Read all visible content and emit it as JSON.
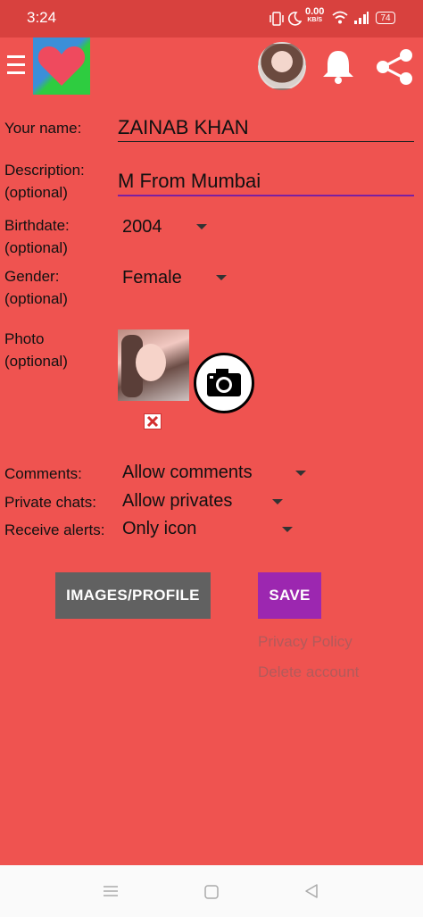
{
  "status_bar": {
    "time": "3:24",
    "net_speed_value": "0.00",
    "net_speed_unit": "KB/S",
    "battery": "74"
  },
  "toolbar": {
    "icons": [
      "menu-icon",
      "app-logo-heart",
      "avatar",
      "bell-icon",
      "share-icon"
    ]
  },
  "form": {
    "name_label": "Your name:",
    "name_value": "ZAINAB KHAN",
    "description_label": "Description:",
    "description_sub": "(optional)",
    "description_value": "M From Mumbai",
    "birthdate_label": "Birthdate:",
    "birthdate_sub": "(optional)",
    "birthdate_value": "2004",
    "gender_label": "Gender:",
    "gender_sub": "(optional)",
    "gender_value": "Female",
    "photo_label": "Photo",
    "photo_sub": "(optional)",
    "comments_label": "Comments:",
    "comments_value": "Allow comments",
    "private_chats_label": "Private chats:",
    "private_chats_value": "Allow privates",
    "alerts_label": "Receive alerts:",
    "alerts_value": "Only icon"
  },
  "buttons": {
    "images_profile": "IMAGES/PROFILE",
    "save": "SAVE"
  },
  "links": {
    "privacy_policy": "Privacy Policy",
    "delete_account": "Delete account"
  },
  "colors": {
    "background": "#ef5350",
    "status_bar": "#d8413e",
    "save_button": "#9c27b0",
    "images_button": "#616161",
    "focus_underline": "#7b1fa2"
  }
}
